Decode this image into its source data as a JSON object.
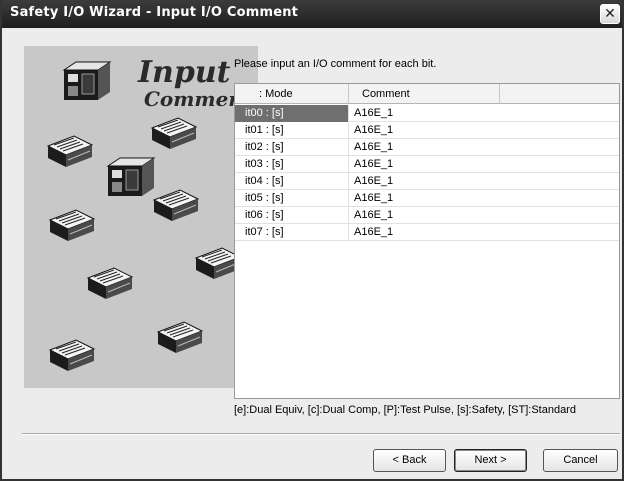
{
  "window": {
    "title": "Safety I/O Wizard - Input I/O Comment",
    "close_glyph": "✕"
  },
  "illustration": {
    "title_line1": "Input",
    "title_line2": "Comment"
  },
  "instruction": "Please input an I/O comment for each bit.",
  "grid": {
    "columns": [
      ": Mode",
      "Comment"
    ],
    "rows": [
      {
        "mode": "it00 : [s]",
        "comment": "A16E_1"
      },
      {
        "mode": "it01 : [s]",
        "comment": "A16E_1"
      },
      {
        "mode": "it02 : [s]",
        "comment": "A16E_1"
      },
      {
        "mode": "it03 : [s]",
        "comment": "A16E_1"
      },
      {
        "mode": "it04 : [s]",
        "comment": "A16E_1"
      },
      {
        "mode": "it05 : [s]",
        "comment": "A16E_1"
      },
      {
        "mode": "it06 : [s]",
        "comment": "A16E_1"
      },
      {
        "mode": "it07 : [s]",
        "comment": "A16E_1"
      }
    ],
    "selected_row": 0
  },
  "legend": "[e]:Dual Equiv, [c]:Dual Comp, [P]:Test Pulse, [s]:Safety, [ST]:Standard",
  "buttons": {
    "back": "< Back",
    "next": "Next >",
    "cancel": "Cancel"
  },
  "colors": {
    "titlebar": "#2a2a2a",
    "selection": "#6f6f6f",
    "panel": "#c8c8c8"
  }
}
